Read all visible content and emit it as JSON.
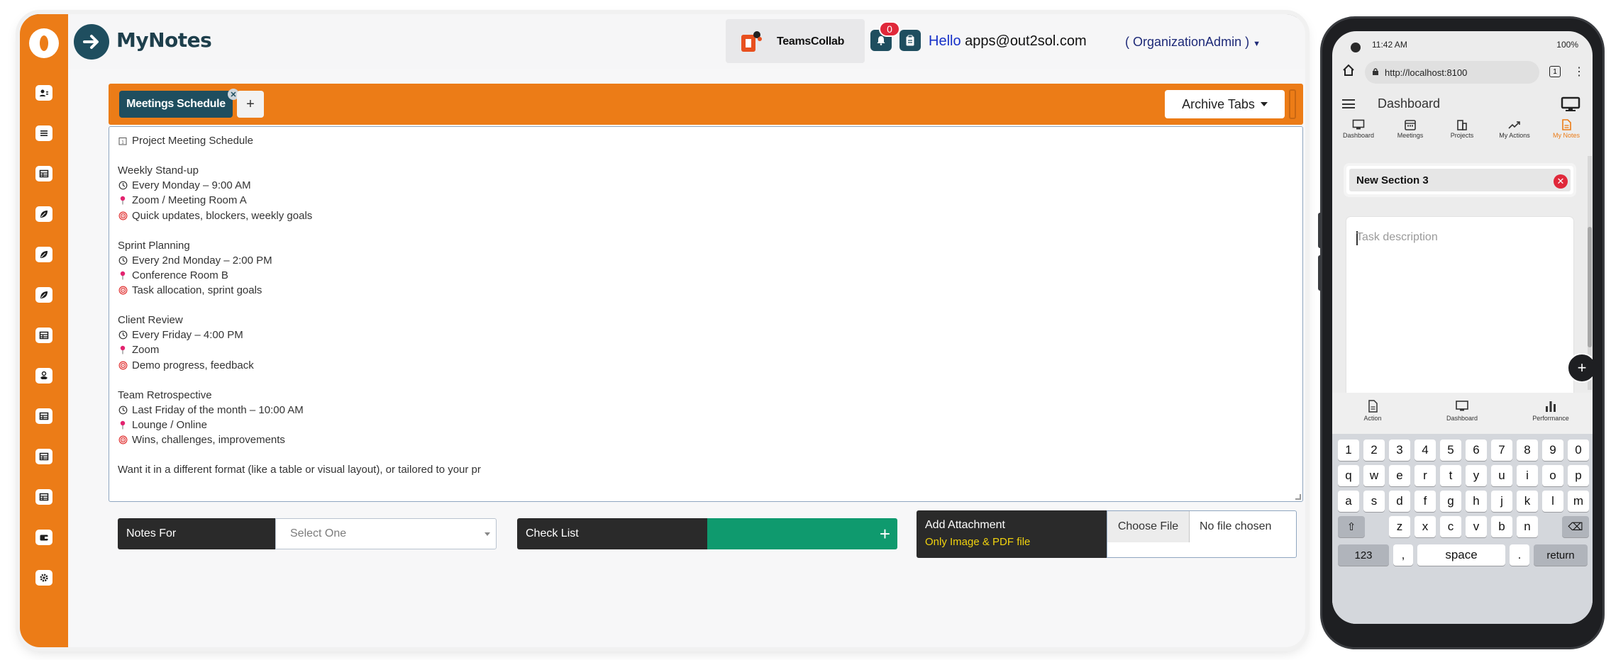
{
  "app": {
    "name": "MyNotes",
    "org": "TeamsCollab",
    "notification_count": "0",
    "greeting": "Hello",
    "user_email": "apps@out2sol.com",
    "role": "( OrganizationAdmin )",
    "brand_color": "#ec7c17",
    "accent_color": "#1f4e5f"
  },
  "sidebar": {
    "items": [
      {
        "icon": "user-icon"
      },
      {
        "icon": "list-icon"
      },
      {
        "icon": "table-icon"
      },
      {
        "icon": "leaf-icon"
      },
      {
        "icon": "leaf-icon"
      },
      {
        "icon": "leaf-icon"
      },
      {
        "icon": "table-icon"
      },
      {
        "icon": "coins-icon"
      },
      {
        "icon": "table-icon"
      },
      {
        "icon": "table-icon"
      },
      {
        "icon": "table-icon"
      },
      {
        "icon": "wallet-icon"
      },
      {
        "icon": "gear-icon"
      }
    ]
  },
  "tabs": {
    "active": "Meetings Schedule",
    "add": "+",
    "archive_label": "Archive Tabs"
  },
  "editor": {
    "lines": [
      {
        "icon": "calendar-icon",
        "text": "Project Meeting Schedule"
      },
      {
        "icon": "",
        "text": ""
      },
      {
        "icon": "",
        "text": "Weekly Stand-up"
      },
      {
        "icon": "clock-icon",
        "text": "Every Monday – 9:00 AM"
      },
      {
        "icon": "pin-icon",
        "text": "Zoom / Meeting Room A"
      },
      {
        "icon": "target-icon",
        "text": "Quick updates, blockers, weekly goals"
      },
      {
        "icon": "",
        "text": ""
      },
      {
        "icon": "",
        "text": "Sprint Planning"
      },
      {
        "icon": "clock-icon",
        "text": "Every 2nd Monday – 2:00 PM"
      },
      {
        "icon": "pin-icon",
        "text": "Conference Room B"
      },
      {
        "icon": "target-icon",
        "text": "Task allocation, sprint goals"
      },
      {
        "icon": "",
        "text": ""
      },
      {
        "icon": "",
        "text": "Client Review"
      },
      {
        "icon": "clock-icon",
        "text": "Every Friday – 4:00 PM"
      },
      {
        "icon": "pin-icon",
        "text": "Zoom"
      },
      {
        "icon": "target-icon",
        "text": "Demo progress, feedback"
      },
      {
        "icon": "",
        "text": ""
      },
      {
        "icon": "",
        "text": "Team Retrospective"
      },
      {
        "icon": "clock-icon",
        "text": "Last Friday of the month – 10:00 AM"
      },
      {
        "icon": "pin-icon",
        "text": "Lounge / Online"
      },
      {
        "icon": "target-icon",
        "text": "Wins, challenges, improvements"
      },
      {
        "icon": "",
        "text": ""
      },
      {
        "icon": "",
        "text": "Want it in a different format (like a table or visual layout), or tailored to your pr"
      }
    ]
  },
  "form": {
    "notes_for_label": "Notes For",
    "notes_for_value": "Select One",
    "checklist_label": "Check List",
    "checklist_add": "+",
    "attachment_label": "Add Attachment",
    "attachment_hint": "Only Image & PDF file",
    "choose_file": "Choose File",
    "no_file": "No file chosen"
  },
  "phone": {
    "time": "11:42 AM",
    "battery": "100%",
    "url": "http://localhost:8100",
    "tab_count": "1",
    "title": "Dashboard",
    "nav": [
      "Dashboard",
      "Meetings",
      "Projects",
      "My Actions",
      "My Notes"
    ],
    "section_title": "New Section 3",
    "task_placeholder": "Task description",
    "bottom_nav": [
      "Action",
      "Dashboard",
      "Performance"
    ],
    "keyboard": {
      "row1": [
        "1",
        "2",
        "3",
        "4",
        "5",
        "6",
        "7",
        "8",
        "9",
        "0"
      ],
      "row2": [
        "q",
        "w",
        "e",
        "r",
        "t",
        "y",
        "u",
        "i",
        "o",
        "p"
      ],
      "row3": [
        "a",
        "s",
        "d",
        "f",
        "g",
        "h",
        "j",
        "k",
        "l",
        "m"
      ],
      "row4": [
        "z",
        "x",
        "c",
        "v",
        "b",
        "n"
      ],
      "num": "123",
      "comma": ",",
      "space": "space",
      "period": ".",
      "return": "return"
    }
  }
}
